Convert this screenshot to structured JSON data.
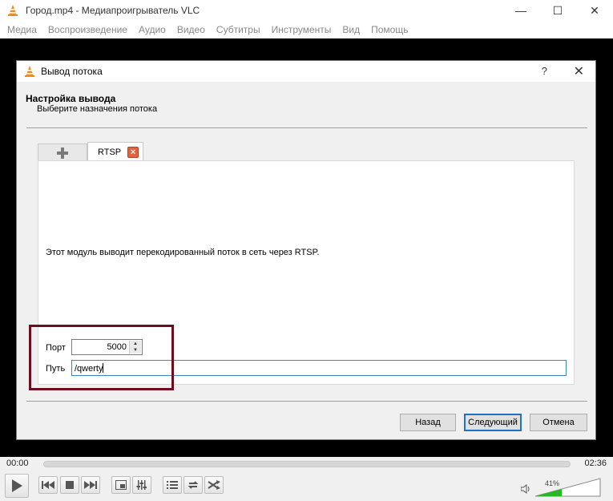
{
  "window": {
    "title": "Город.mp4 - Медиапроигрыватель VLC",
    "controls": [
      "—",
      "☐",
      "✕"
    ]
  },
  "menu": [
    "Медиа",
    "Воспроизведение",
    "Аудио",
    "Видео",
    "Субтитры",
    "Инструменты",
    "Вид",
    "Помощь"
  ],
  "dialog": {
    "title": "Вывод потока",
    "help": "?",
    "close": "✕",
    "header_title": "Настройка вывода",
    "header_subtitle": "Выберите назначения потока",
    "tabs": {
      "add_symbol": "+",
      "rtsp_label": "RTSP",
      "rtsp_close": "×"
    },
    "description": "Этот модуль выводит перекодированный поток в сеть через RTSP.",
    "port_label": "Порт",
    "port_value": "5000",
    "path_label": "Путь",
    "path_value": "/qwerty",
    "buttons": {
      "back": "Назад",
      "next": "Следующий",
      "cancel": "Отмена"
    }
  },
  "player": {
    "time_current": "00:00",
    "time_total": "02:36",
    "volume": "41%",
    "volume_level": 0.41
  }
}
